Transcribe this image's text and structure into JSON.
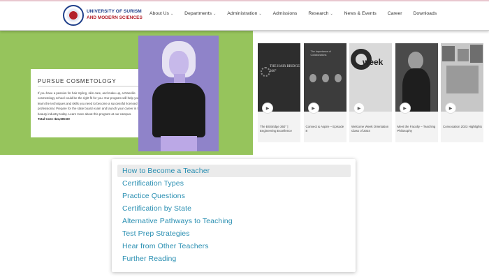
{
  "header": {
    "brand_line1": "UNIVERSITY OF SURISM",
    "brand_line2": "AND MODERN SCIENCES",
    "nav": [
      {
        "label": "About Us",
        "has_dropdown": true
      },
      {
        "label": "Departments",
        "has_dropdown": true
      },
      {
        "label": "Administration",
        "has_dropdown": true
      },
      {
        "label": "Admissions",
        "has_dropdown": false
      },
      {
        "label": "Research",
        "has_dropdown": true
      },
      {
        "label": "News & Events",
        "has_dropdown": false
      },
      {
        "label": "Career",
        "has_dropdown": false
      },
      {
        "label": "Downloads",
        "has_dropdown": false
      }
    ]
  },
  "hero": {
    "title": "PURSUE COSMETOLOGY",
    "body": "If you have a passion for hair styling, skin care, and make-up, a Danville cosmetology school could be the right fit for you. Our program will help you learn the techniques and skills you need to become a successful licensed professional. Prepare for the state board exam and launch your career in the beauty industry today. Learn more about this program at our campus.",
    "total": "Total Cost: $24,500.00",
    "accent_color": "#96c45c"
  },
  "videos": [
    {
      "title": "The Bit Bridge 360° | Engineering Excellence",
      "thumb_text": "THE HAIR BRIDGE 360°"
    },
    {
      "title": "Connect & Aspire – Episode 8",
      "thumb_text": "The Importance of Collaborations"
    },
    {
      "title": "Welcome Week Orientation Class of 2024",
      "thumb_text": "week"
    },
    {
      "title": "Meet the Faculty – Teaching Philosophy",
      "thumb_text": ""
    },
    {
      "title": "Convocation 2023 Highlights",
      "thumb_text": ""
    }
  ],
  "menu": {
    "items": [
      "How to Become a Teacher",
      "Certification Types",
      "Practice Questions",
      "Certification by State",
      "Alternative Pathways to Teaching",
      "Test Prep Strategies",
      "Hear from Other Teachers",
      "Further Reading"
    ],
    "active_index": 0,
    "link_color": "#2a8fb2"
  }
}
